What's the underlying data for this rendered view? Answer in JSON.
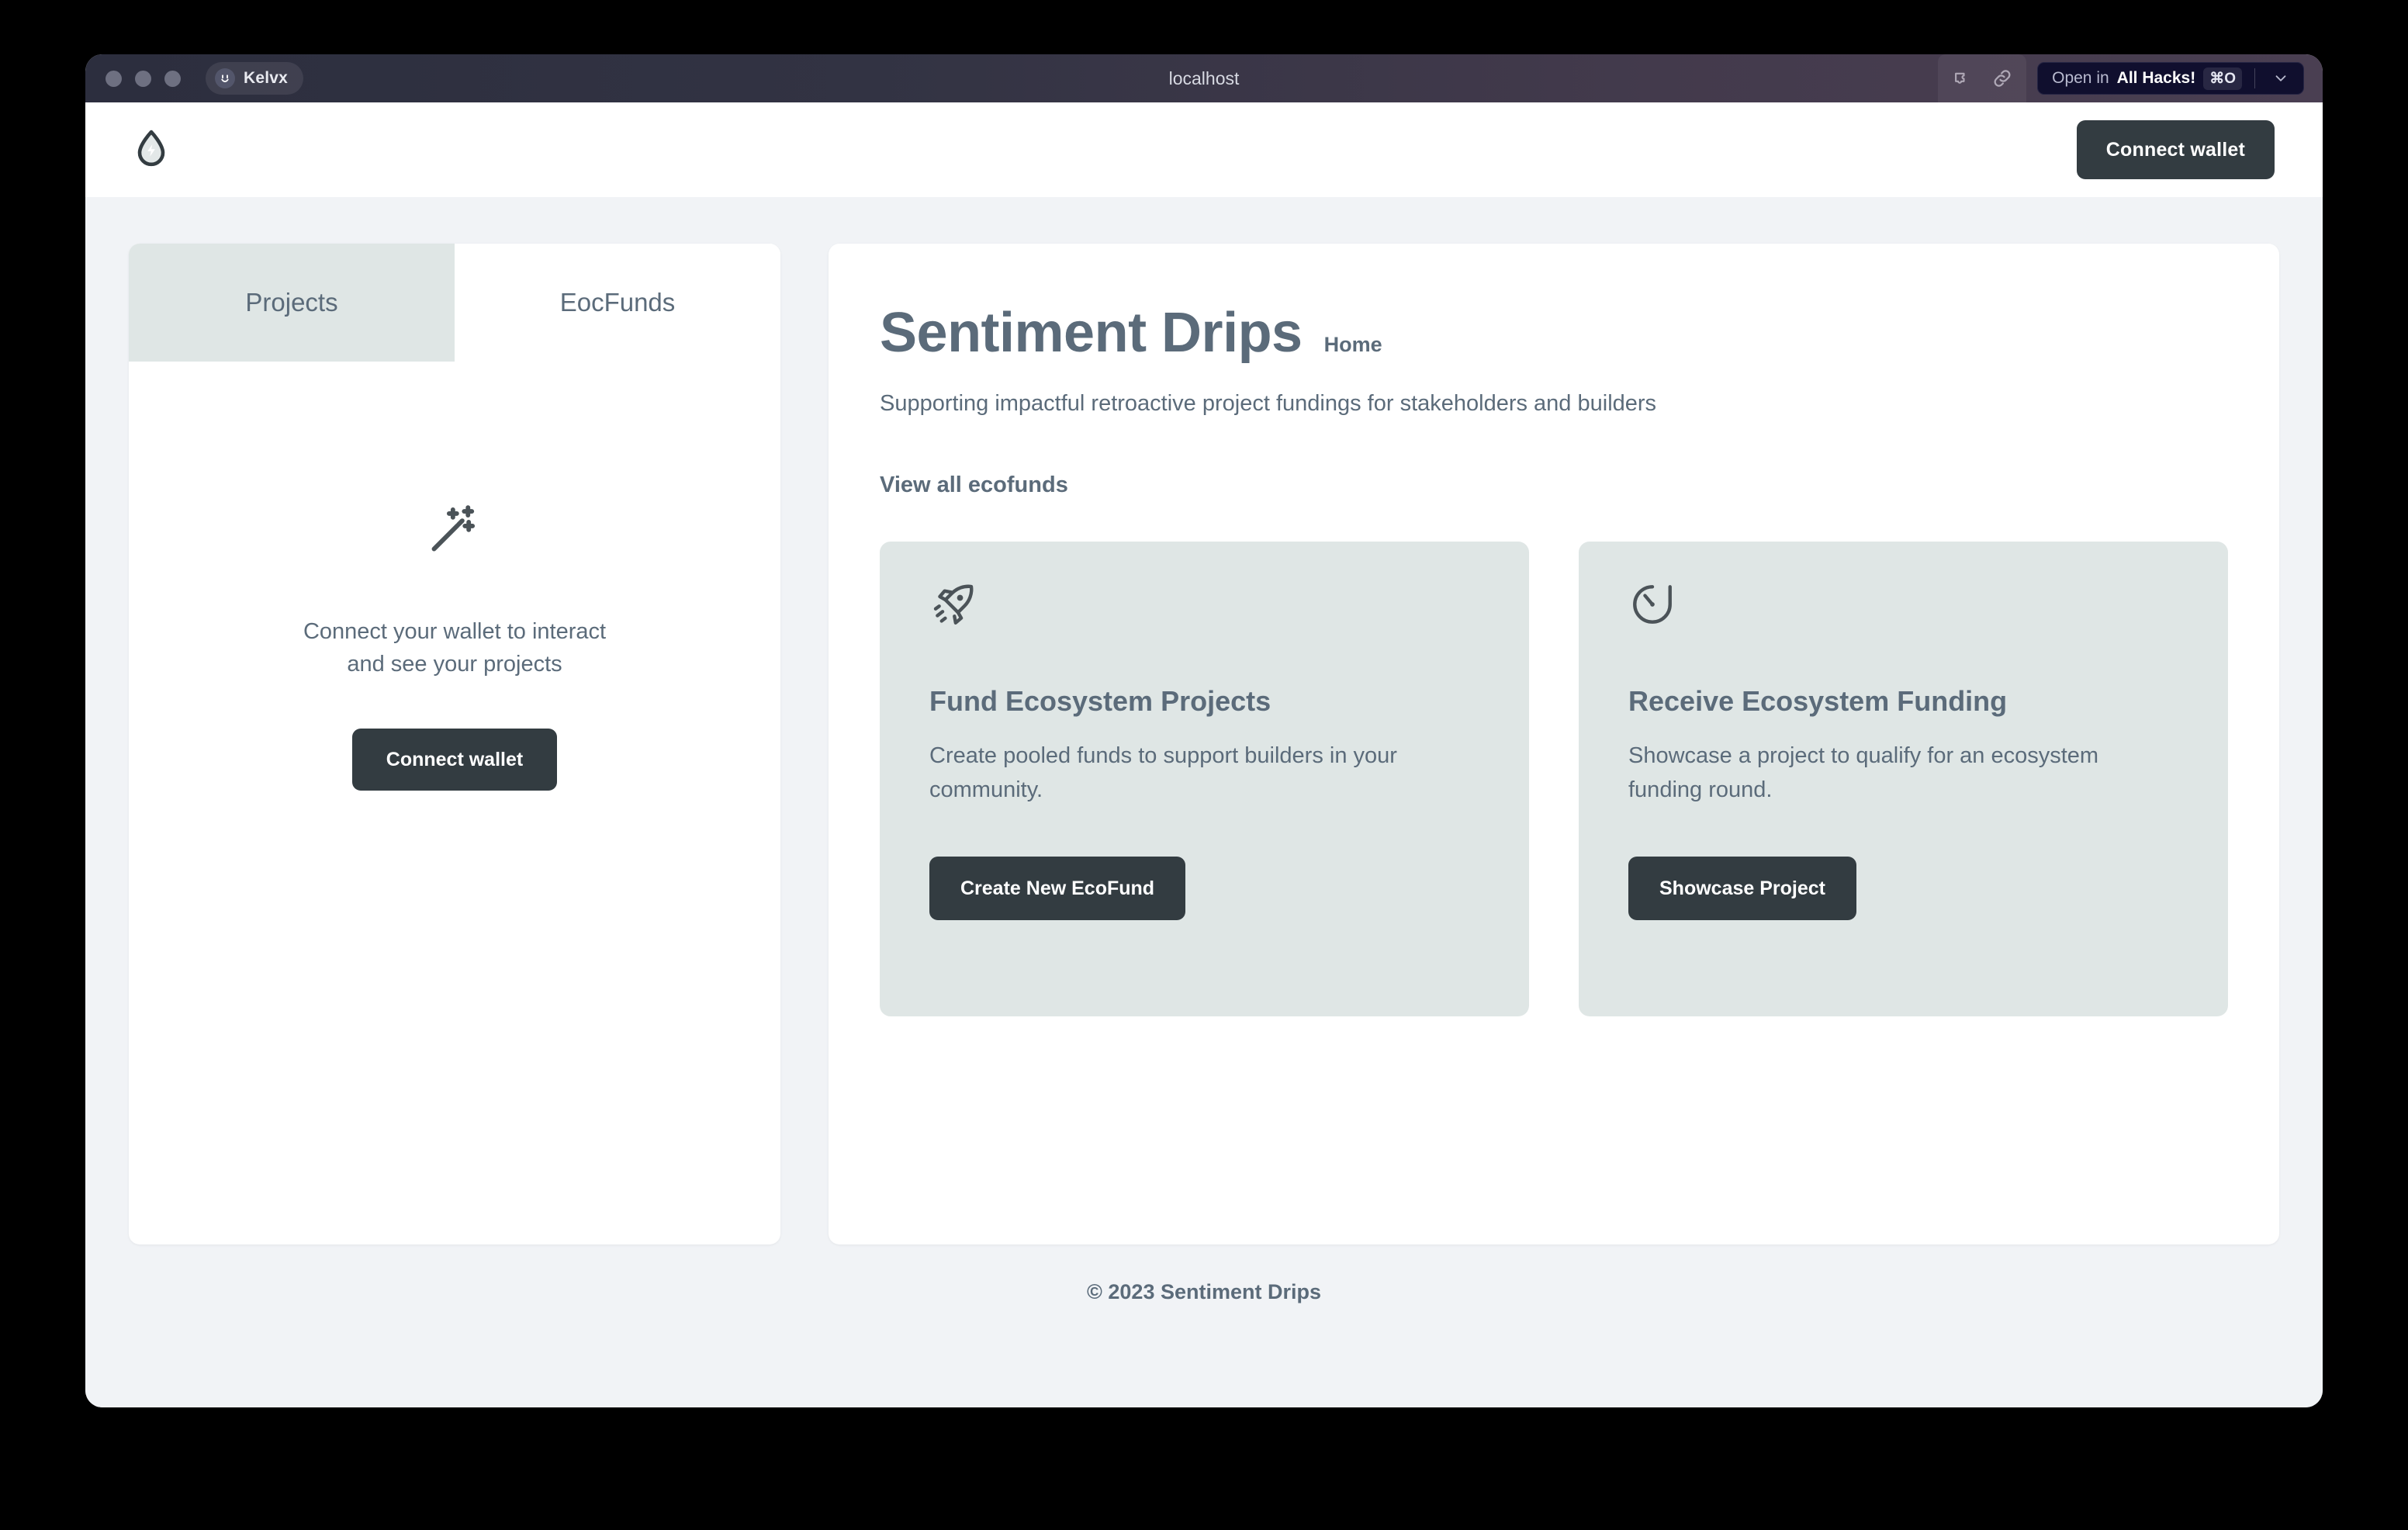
{
  "browser": {
    "profile_name": "Kelvx",
    "address_title": "localhost",
    "open_in": {
      "prefix": "Open in",
      "app": "All Hacks!",
      "shortcut": "⌘O"
    }
  },
  "header": {
    "connect_wallet_label": "Connect wallet"
  },
  "left_panel": {
    "tabs": [
      {
        "label": "Projects",
        "active": true
      },
      {
        "label": "EocFunds",
        "active": false
      }
    ],
    "empty_state": {
      "line1": "Connect your wallet to interact",
      "line2": "and see your projects",
      "button_label": "Connect wallet"
    }
  },
  "main": {
    "title": "Sentiment Drips",
    "breadcrumb": "Home",
    "subtitle": "Supporting impactful retroactive project fundings for stakeholders and builders",
    "view_all_link": "View all ecofunds",
    "cards": [
      {
        "icon": "rocket-icon",
        "title": "Fund Ecosystem Projects",
        "description": "Create pooled funds to support builders in your community.",
        "button_label": "Create New EcoFund"
      },
      {
        "icon": "stopwatch-icon",
        "title": "Receive Ecosystem Funding",
        "description": "Showcase a project to qualify for an ecosystem funding round.",
        "button_label": "Showcase Project"
      }
    ]
  },
  "footer": {
    "copyright": "© 2023 Sentiment Drips"
  },
  "colors": {
    "accent_dark": "#333c41",
    "text_muted": "#5b6b7a",
    "card_bg": "#dfe6e5",
    "page_bg": "#f1f3f6",
    "titlebar_left": "#2c2e3e",
    "titlebar_right": "#4a3f52",
    "open_in_pill": "#100f2e"
  }
}
